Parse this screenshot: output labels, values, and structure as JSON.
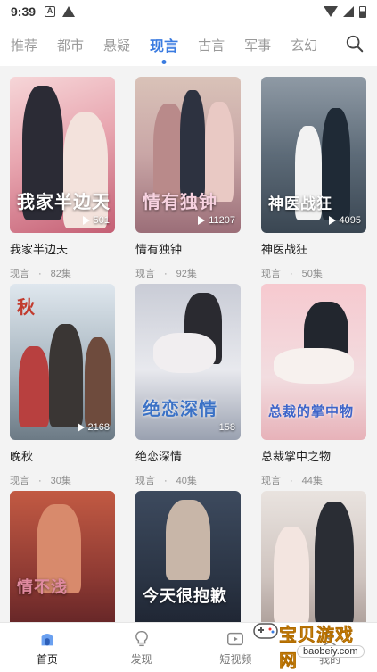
{
  "status": {
    "time": "9:39"
  },
  "tabs": [
    {
      "label": "推荐"
    },
    {
      "label": "都市"
    },
    {
      "label": "悬疑"
    },
    {
      "label": "现言",
      "active": true
    },
    {
      "label": "古言"
    },
    {
      "label": "军事"
    },
    {
      "label": "玄幻"
    }
  ],
  "colors": {
    "accent": "#3a7be0",
    "watermark": "#f7a81b"
  },
  "cards": [
    {
      "title": "我家半边天",
      "poster_text": "我家半边天",
      "views": "501",
      "category": "现言",
      "dot": "·",
      "episodes": "82集"
    },
    {
      "title": "情有独钟",
      "poster_text": "情有独钟",
      "views": "11207",
      "category": "现言",
      "dot": "·",
      "episodes": "92集"
    },
    {
      "title": "神医战狂",
      "poster_text": "神医战狂",
      "views": "4095",
      "category": "现言",
      "dot": "·",
      "episodes": "50集"
    },
    {
      "title": "晚秋",
      "poster_text": "秋",
      "views": "2168",
      "category": "现言",
      "dot": "·",
      "episodes": "30集"
    },
    {
      "title": "绝恋深情",
      "poster_text": "绝恋深情",
      "views": "158",
      "category": "现言",
      "dot": "·",
      "episodes": "40集"
    },
    {
      "title": "总裁掌中之物",
      "poster_text": "总裁的掌中物",
      "views": "",
      "category": "现言",
      "dot": "·",
      "episodes": "44集"
    },
    {
      "title": "",
      "poster_text": "情不浅",
      "views": "",
      "category": "",
      "dot": "",
      "episodes": ""
    },
    {
      "title": "",
      "poster_text": "今天很抱歉",
      "views": "",
      "category": "",
      "dot": "",
      "episodes": ""
    },
    {
      "title": "",
      "poster_text": "",
      "views": "",
      "category": "",
      "dot": "",
      "episodes": ""
    }
  ],
  "nav": [
    {
      "label": "首页",
      "icon": "home-icon",
      "active": true
    },
    {
      "label": "发现",
      "icon": "bulb-icon"
    },
    {
      "label": "短视频",
      "icon": "video-icon"
    },
    {
      "label": "我的",
      "icon": "user-icon"
    }
  ],
  "watermark": {
    "text": "宝贝游戏网",
    "url": "baobeiy.com"
  }
}
